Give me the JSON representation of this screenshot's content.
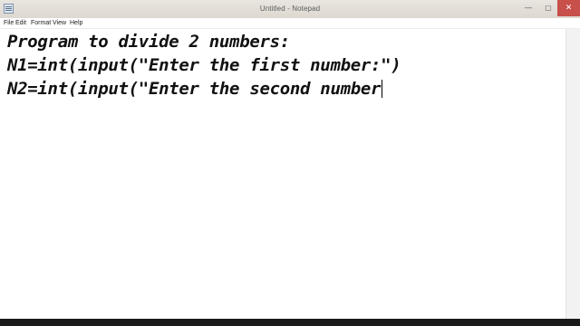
{
  "window": {
    "title": "Untitled - Notepad",
    "controls": {
      "minimize": "—",
      "maximize": "▢",
      "close": "✕"
    }
  },
  "menu": {
    "items": [
      "File",
      "Edit",
      "Format",
      "View",
      "Help"
    ]
  },
  "editor": {
    "lines": [
      "Program to divide 2 numbers:",
      "N1=int(input(\"Enter the first number:\")",
      "N2=int(input(\"Enter the second number"
    ]
  }
}
